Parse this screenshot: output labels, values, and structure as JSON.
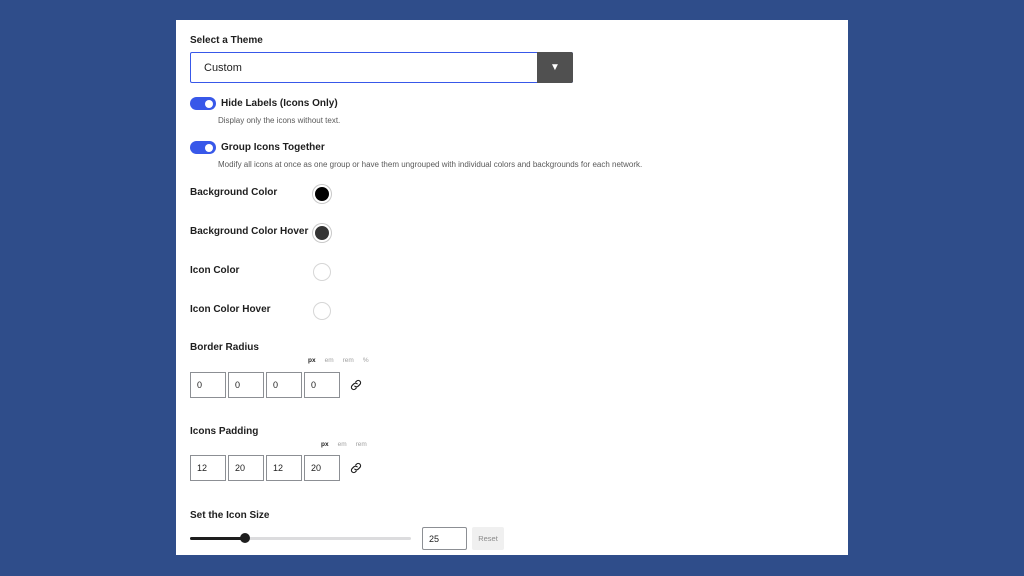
{
  "theme": {
    "label": "Select a Theme",
    "value": "Custom",
    "arrow": "▼"
  },
  "hide_labels": {
    "title": "Hide Labels (Icons Only)",
    "help": "Display only the icons without text.",
    "enabled": true
  },
  "group_icons": {
    "title": "Group Icons Together",
    "help": "Modify all icons at once as one group or have them ungrouped with individual colors and backgrounds for each network.",
    "enabled": true
  },
  "colors": [
    {
      "label": "Background Color",
      "value": "#000000"
    },
    {
      "label": "Background Color Hover",
      "value": "#333333"
    },
    {
      "label": "Icon Color",
      "value": "#ffffff"
    },
    {
      "label": "Icon Color Hover",
      "value": "#ffffff"
    }
  ],
  "border_radius": {
    "label": "Border Radius",
    "units": [
      "px",
      "em",
      "rem",
      "%"
    ],
    "active_unit": "px",
    "values": [
      "0",
      "0",
      "0",
      "0"
    ],
    "link_icon": "link-icon"
  },
  "icons_padding": {
    "label": "Icons Padding",
    "units": [
      "px",
      "em",
      "rem"
    ],
    "active_unit": "px",
    "values": [
      "12",
      "20",
      "12",
      "20"
    ],
    "link_icon": "link-icon"
  },
  "icon_size": {
    "label": "Set the Icon Size",
    "value": "25",
    "min": 0,
    "max": 100,
    "reset_label": "Reset"
  },
  "accent_color": "#3858e9"
}
